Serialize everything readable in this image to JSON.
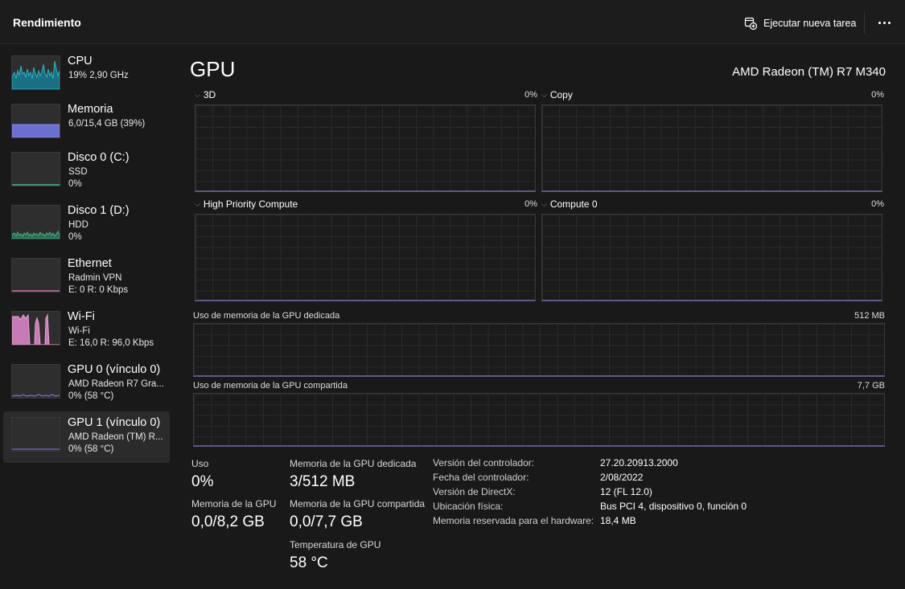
{
  "header": {
    "title": "Rendimiento",
    "run_task_label": "Ejecutar nueva tarea",
    "run_task_icon": "new-task-icon",
    "more_icon": "more-options-icon"
  },
  "sidebar": {
    "items": [
      {
        "name": "CPU",
        "sub1": "19%  2,90 GHz",
        "sub2": "",
        "color": "#2bb3c9"
      },
      {
        "name": "Memoria",
        "sub1": "6,0/15,4 GB (39%)",
        "sub2": "",
        "color": "#7a7fe6",
        "level": 0.39
      },
      {
        "name": "Disco 0 (C:)",
        "sub1": "SSD",
        "sub2": "0%",
        "color": "#49b384"
      },
      {
        "name": "Disco 1 (D:)",
        "sub1": "HDD",
        "sub2": "0%",
        "color": "#49b384"
      },
      {
        "name": "Ethernet",
        "sub1": "Radmin VPN",
        "sub2": "E: 0  R: 0 Kbps",
        "color": "#c46ea6"
      },
      {
        "name": "Wi-Fi",
        "sub1": "Wi-Fi",
        "sub2": "E: 16,0  R: 96,0 Kbps",
        "color": "#d57ac0"
      },
      {
        "name": "GPU 0 (vínculo 0)",
        "sub1": "AMD Radeon R7 Gra...",
        "sub2": "0%  (58 °C)",
        "color": "#8b6fd6"
      },
      {
        "name": "GPU 1 (vínculo 0)",
        "sub1": "AMD Radeon (TM) R...",
        "sub2": "0%  (58 °C)",
        "color": "#6a6ad0"
      }
    ],
    "selected_index": 7
  },
  "main": {
    "title": "GPU",
    "model": "AMD Radeon (TM) R7 M340",
    "engines": [
      {
        "label": "3D",
        "value": "0%"
      },
      {
        "label": "Copy",
        "value": "0%"
      },
      {
        "label": "High Priority Compute",
        "value": "0%"
      },
      {
        "label": "Compute 0",
        "value": "0%"
      }
    ],
    "dedicated_label": "Uso de memoria de la GPU dedicada",
    "dedicated_max": "512 MB",
    "shared_label": "Uso de memoria de la GPU compartida",
    "shared_max": "7,7 GB"
  },
  "stats": {
    "usage_label": "Uso",
    "usage_value": "0%",
    "gpu_mem_label": "Memoria de la GPU",
    "gpu_mem_value": "0,0/8,2 GB",
    "dedicated_label": "Memoria de la GPU dedicada",
    "dedicated_value": "3/512 MB",
    "shared_label": "Memoria de la GPU compartida",
    "shared_value": "0,0/7,7 GB",
    "temp_label": "Temperatura de GPU",
    "temp_value": "58 °C"
  },
  "info": [
    {
      "key": "Versión del controlador:",
      "value": "27.20.20913.2000"
    },
    {
      "key": "Fecha del controlador:",
      "value": "2/08/2022"
    },
    {
      "key": "Versión de DirectX:",
      "value": "12 (FL 12.0)"
    },
    {
      "key": "Ubicación física:",
      "value": "Bus PCI 4, dispositivo 0, función 0"
    },
    {
      "key": "Memoria reservada para el hardware:",
      "value": "18,4 MB"
    }
  ]
}
